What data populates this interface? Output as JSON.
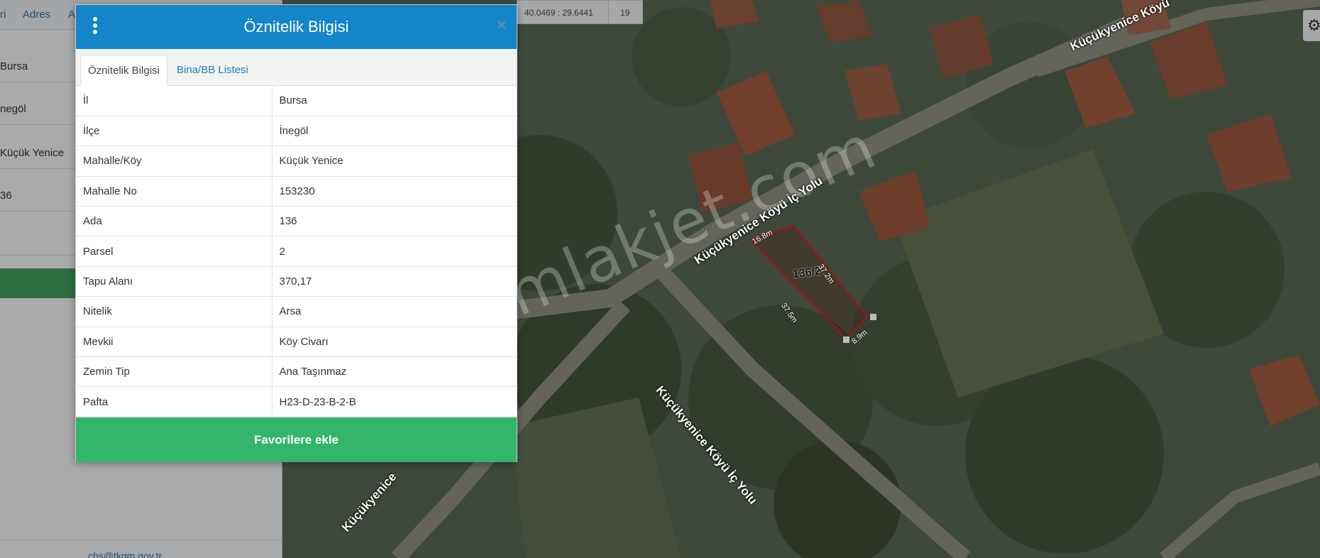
{
  "sidebar": {
    "tabs": [
      {
        "label": "ri"
      },
      {
        "label": "Adres"
      },
      {
        "label": "A"
      }
    ],
    "rows": [
      "Bursa",
      "negöl",
      "Küçük Yenice",
      "36",
      ""
    ],
    "footer_link": "cbs@tkgm.gov.tr"
  },
  "coords": {
    "latlon": "40.0469 : 29.6441",
    "zoom": "19"
  },
  "map": {
    "watermark": "emlakjet.com",
    "road_labels": [
      "Küçükyenice Köyü İç Yolu",
      "Küçükyenice Köyü İç Yolu",
      "Küçükyenice Köyü",
      "Küçükyenice"
    ],
    "parcel_label": "136/2",
    "dimensions": [
      "16.8m",
      "37.2m",
      "37.5m",
      "8.9m"
    ]
  },
  "modal": {
    "title": "Öznitelik Bilgisi",
    "close_symbol": "×",
    "tabs": [
      {
        "label": "Öznitelik Bilgisi",
        "active": true
      },
      {
        "label": "Bina/BB Listesi",
        "active": false
      }
    ],
    "rows": [
      {
        "key": "İl",
        "value": "Bursa"
      },
      {
        "key": "İlçe",
        "value": "İnegöl"
      },
      {
        "key": "Mahalle/Köy",
        "value": "Küçük Yenice"
      },
      {
        "key": "Mahalle No",
        "value": "153230"
      },
      {
        "key": "Ada",
        "value": "136"
      },
      {
        "key": "Parsel",
        "value": "2"
      },
      {
        "key": "Tapu Alanı",
        "value": "370,17"
      },
      {
        "key": "Nitelik",
        "value": "Arsa"
      },
      {
        "key": "Mevkii",
        "value": "Köy Civarı"
      },
      {
        "key": "Zemin Tip",
        "value": "Ana Taşınmaz"
      },
      {
        "key": "Pafta",
        "value": "H23-D-23-B-2-B"
      }
    ],
    "favorite_button": "Favorilere ekle"
  },
  "colors": {
    "header": "#1385c8",
    "favorite": "#33b56a",
    "parcel_outline": "#b01f2a"
  }
}
